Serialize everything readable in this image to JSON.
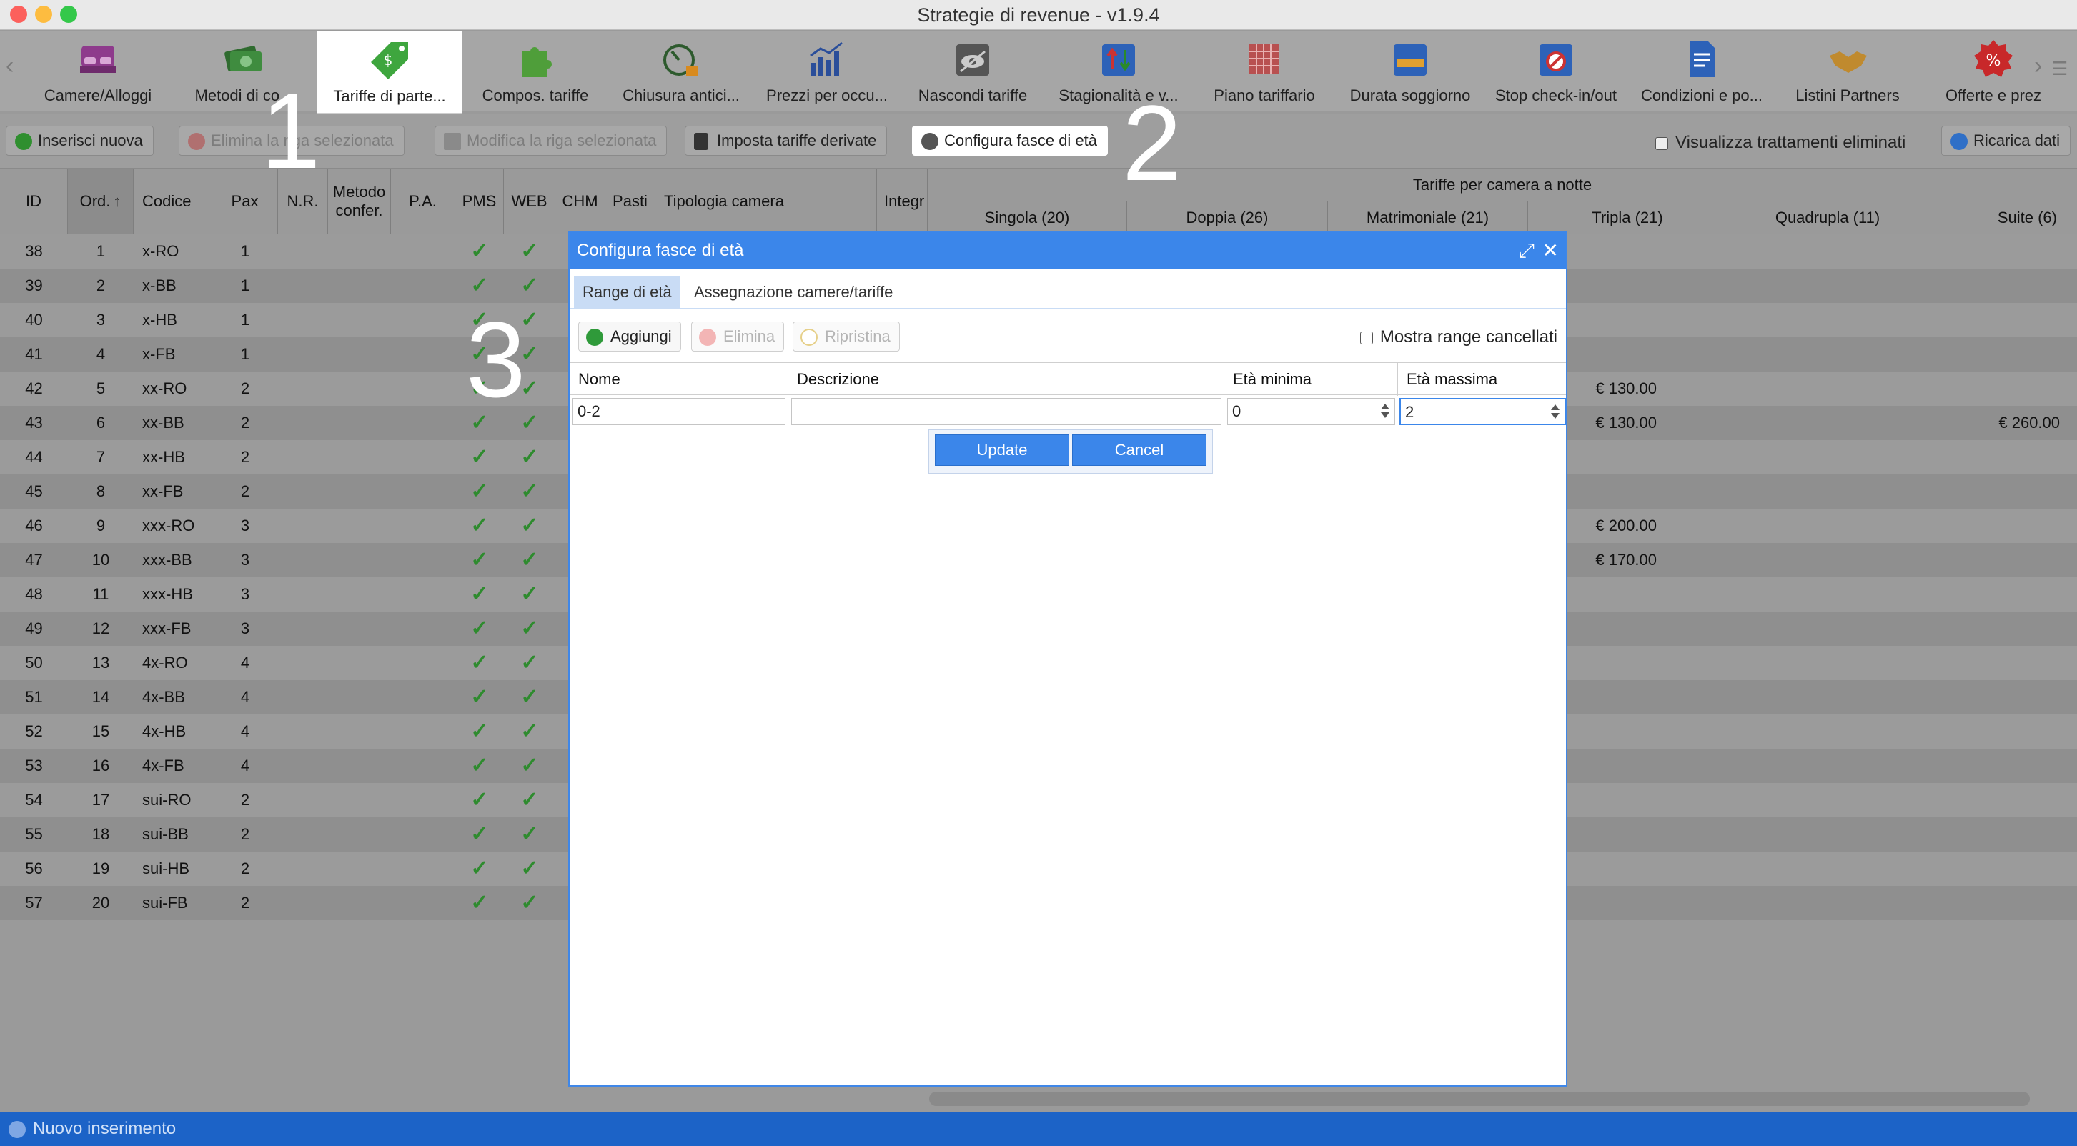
{
  "window": {
    "title": "Strategie di revenue - v1.9.4"
  },
  "toolbar": {
    "items": [
      {
        "label": "Camere/Alloggi",
        "icon": "bed-icon"
      },
      {
        "label": "Metodi di co...",
        "icon": "money-icon"
      },
      {
        "label": "Tariffe di parte...",
        "icon": "price-tag-icon"
      },
      {
        "label": "Compos. tariffe",
        "icon": "puzzle-icon"
      },
      {
        "label": "Chiusura antici...",
        "icon": "stopwatch-lock-icon"
      },
      {
        "label": "Prezzi per occu...",
        "icon": "bar-chart-icon"
      },
      {
        "label": "Nascondi tariffe",
        "icon": "eye-hidden-icon"
      },
      {
        "label": "Stagionalità e v...",
        "icon": "calendar-arrows-icon"
      },
      {
        "label": "Piano tariffario",
        "icon": "grid-plan-icon"
      },
      {
        "label": "Durata soggiorno",
        "icon": "calendar-ruler-icon"
      },
      {
        "label": "Stop check-in/out",
        "icon": "calendar-stop-icon"
      },
      {
        "label": "Condizioni e po...",
        "icon": "document-sign-icon"
      },
      {
        "label": "Listini Partners",
        "icon": "handshake-icon"
      },
      {
        "label": "Offerte e prez",
        "icon": "discount-badge-icon"
      }
    ]
  },
  "actions": {
    "insert": "Inserisci nuova",
    "delete": "Elimina la riga selezionata",
    "edit": "Modifica la riga selezionata",
    "derived": "Imposta tariffe derivate",
    "age_bands": "Configura fasce di età",
    "show_deleted": "Visualizza trattamenti eliminati",
    "reload": "Ricarica dati"
  },
  "grid": {
    "columns": {
      "id": "ID",
      "ord": "Ord.",
      "codice": "Codice",
      "pax": "Pax",
      "nr": "N.R.",
      "metodo": "Metodo confer.",
      "pa": "P.A.",
      "pms": "PMS",
      "web": "WEB",
      "chm": "CHM",
      "pasti": "Pasti",
      "tipologia": "Tipologia camera",
      "integ": "Integr"
    },
    "group_header": "Tariffe per camera a notte",
    "room_columns": [
      "Singola (20)",
      "Doppia (26)",
      "Matrimoniale (21)",
      "Tripla (21)",
      "Quadrupla (11)",
      "Suite (6)"
    ],
    "rows": [
      {
        "id": "38",
        "ord": "1",
        "codice": "x-RO",
        "pax": "1",
        "tripla": "",
        "suite": ""
      },
      {
        "id": "39",
        "ord": "2",
        "codice": "x-BB",
        "pax": "1",
        "tripla": "",
        "suite": ""
      },
      {
        "id": "40",
        "ord": "3",
        "codice": "x-HB",
        "pax": "1",
        "tripla": "",
        "suite": ""
      },
      {
        "id": "41",
        "ord": "4",
        "codice": "x-FB",
        "pax": "1",
        "tripla": "",
        "suite": ""
      },
      {
        "id": "42",
        "ord": "5",
        "codice": "xx-RO",
        "pax": "2",
        "tripla": "€ 130.00",
        "suite": ""
      },
      {
        "id": "43",
        "ord": "6",
        "codice": "xx-BB",
        "pax": "2",
        "tripla": "€ 130.00",
        "suite": "€ 260.00"
      },
      {
        "id": "44",
        "ord": "7",
        "codice": "xx-HB",
        "pax": "2",
        "tripla": "",
        "suite": ""
      },
      {
        "id": "45",
        "ord": "8",
        "codice": "xx-FB",
        "pax": "2",
        "tripla": "",
        "suite": ""
      },
      {
        "id": "46",
        "ord": "9",
        "codice": "xxx-RO",
        "pax": "3",
        "tripla": "€ 200.00",
        "suite": ""
      },
      {
        "id": "47",
        "ord": "10",
        "codice": "xxx-BB",
        "pax": "3",
        "tripla": "€ 170.00",
        "suite": ""
      },
      {
        "id": "48",
        "ord": "11",
        "codice": "xxx-HB",
        "pax": "3",
        "tripla": "",
        "suite": ""
      },
      {
        "id": "49",
        "ord": "12",
        "codice": "xxx-FB",
        "pax": "3",
        "tripla": "",
        "suite": ""
      },
      {
        "id": "50",
        "ord": "13",
        "codice": "4x-RO",
        "pax": "4",
        "tripla": "",
        "suite": ""
      },
      {
        "id": "51",
        "ord": "14",
        "codice": "4x-BB",
        "pax": "4",
        "tripla": "",
        "suite": ""
      },
      {
        "id": "52",
        "ord": "15",
        "codice": "4x-HB",
        "pax": "4",
        "tripla": "",
        "suite": ""
      },
      {
        "id": "53",
        "ord": "16",
        "codice": "4x-FB",
        "pax": "4",
        "tripla": "",
        "suite": ""
      },
      {
        "id": "54",
        "ord": "17",
        "codice": "sui-RO",
        "pax": "2",
        "tripla": "",
        "suite": ""
      },
      {
        "id": "55",
        "ord": "18",
        "codice": "sui-BB",
        "pax": "2",
        "tripla": "",
        "suite": ""
      },
      {
        "id": "56",
        "ord": "19",
        "codice": "sui-HB",
        "pax": "2",
        "tripla": "",
        "suite": ""
      },
      {
        "id": "57",
        "ord": "20",
        "codice": "sui-FB",
        "pax": "2",
        "tripla": "",
        "suite": ""
      }
    ]
  },
  "callouts": [
    "1",
    "2",
    "3"
  ],
  "dialog": {
    "title": "Configura fasce di età",
    "tabs": [
      "Range di età",
      "Assegnazione camere/tariffe"
    ],
    "buttons": {
      "add": "Aggiungi",
      "delete": "Elimina",
      "restore": "Ripristina"
    },
    "show_deleted": "Mostra range cancellati",
    "columns": [
      "Nome",
      "Descrizione",
      "Età minima",
      "Età massima"
    ],
    "edit_row": {
      "nome": "0-2",
      "descrizione": "",
      "eta_min": "0",
      "eta_max": "2"
    },
    "update": "Update",
    "cancel": "Cancel"
  },
  "status": {
    "text": "Nuovo inserimento"
  },
  "colors": {
    "accent": "#3b86ea",
    "status_bar": "#1c63c7",
    "check": "#2e8b2e"
  }
}
